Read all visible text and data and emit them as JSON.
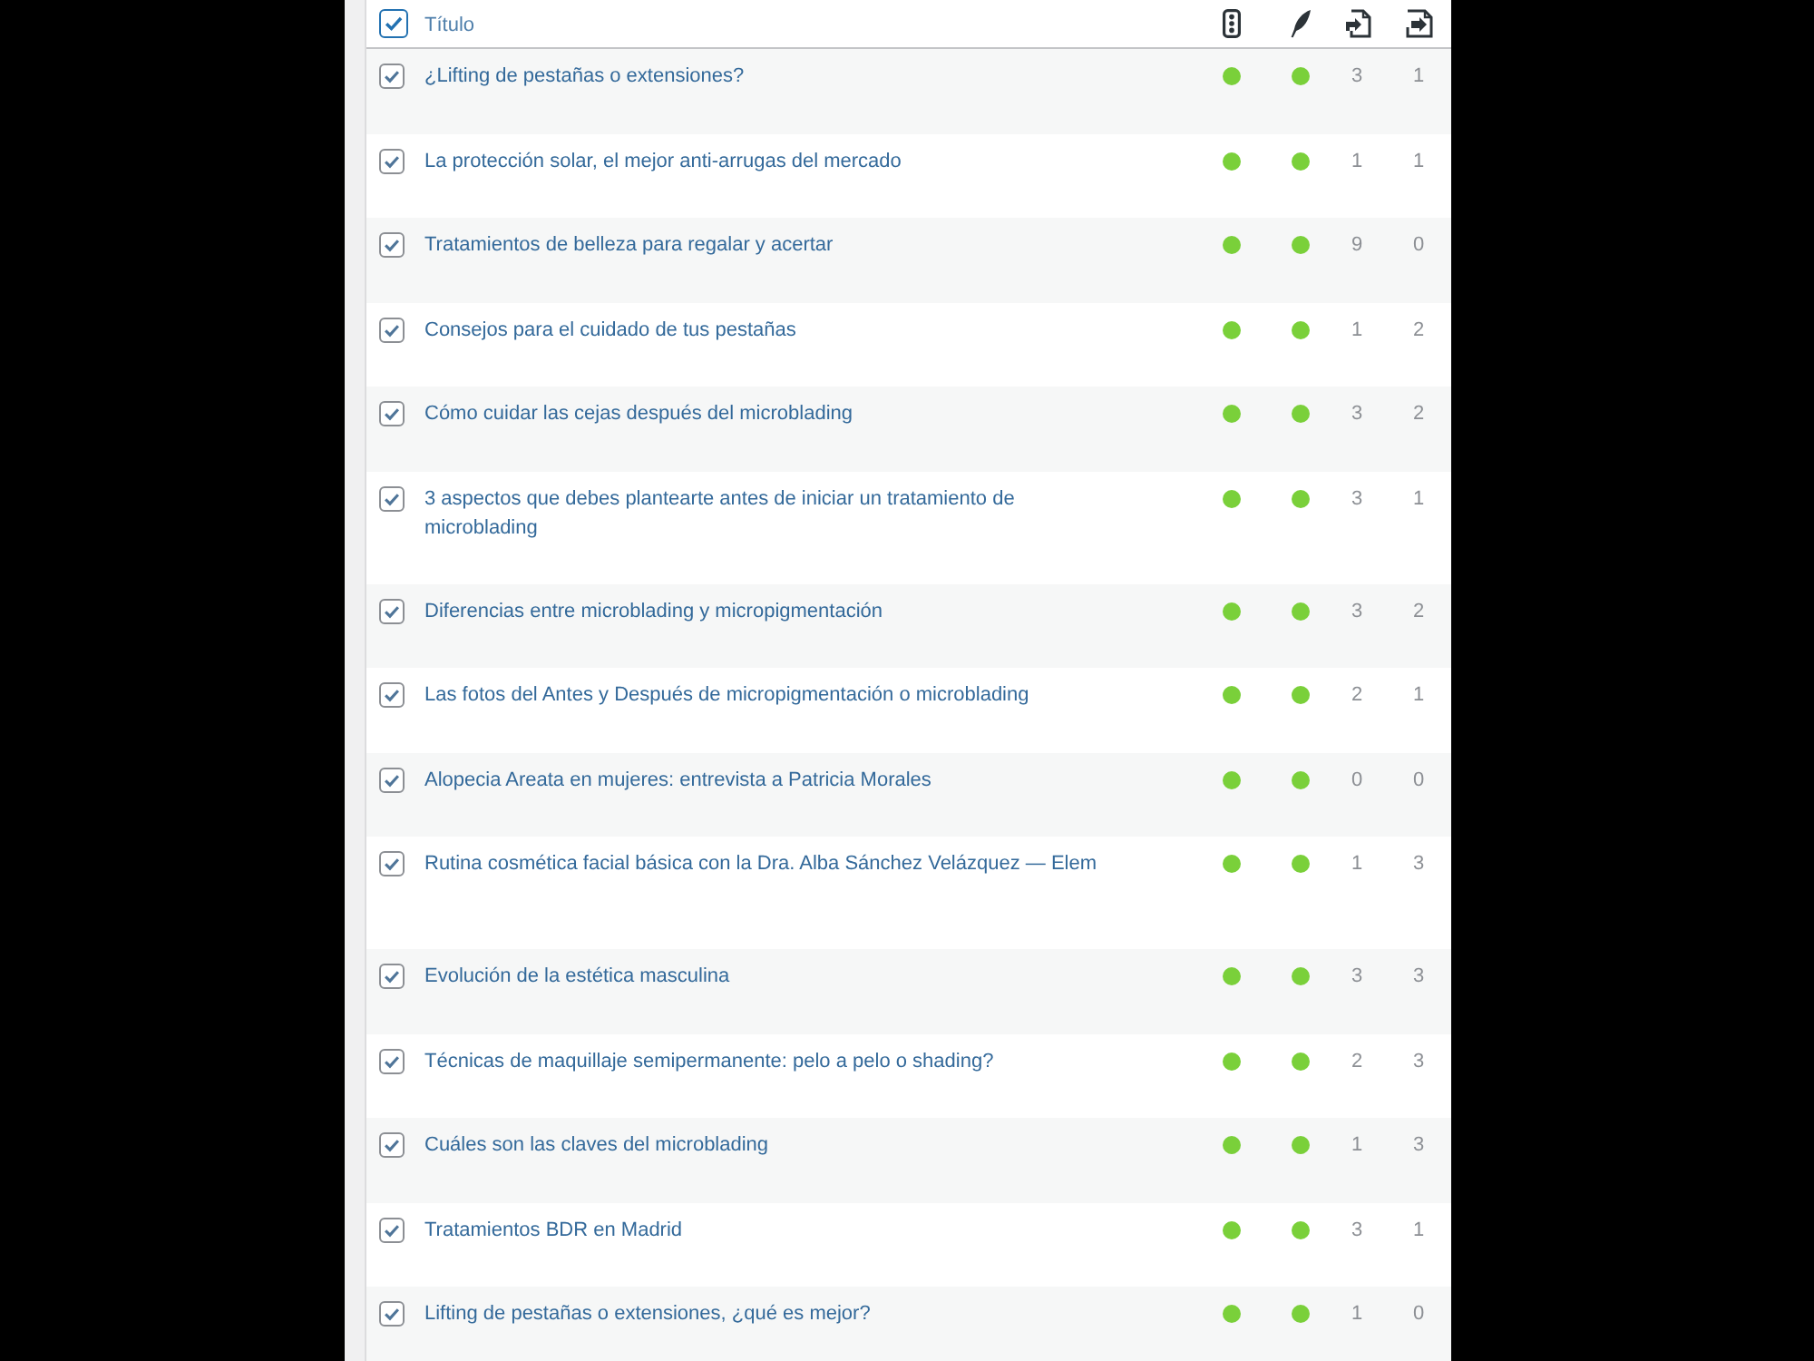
{
  "table": {
    "header": {
      "checked": true,
      "title": "Título"
    },
    "rows": [
      {
        "checked": true,
        "title": "¿Lifting de pestañas o extensiones?",
        "dots": [
          {
            "color": "#7ad03a"
          },
          {
            "color": "#7ad03a"
          }
        ],
        "counts": [
          "3",
          "1"
        ]
      },
      {
        "checked": true,
        "title": "La protección solar, el mejor anti-arrugas del mercado",
        "dots": [
          {
            "color": "#7ad03a"
          },
          {
            "color": "#7ad03a"
          }
        ],
        "counts": [
          "1",
          "1"
        ]
      },
      {
        "checked": true,
        "title": "Tratamientos de belleza para regalar y acertar",
        "dots": [
          {
            "color": "#7ad03a"
          },
          {
            "color": "#7ad03a"
          }
        ],
        "counts": [
          "9",
          "0"
        ]
      },
      {
        "checked": true,
        "title": "Consejos para el cuidado de tus pestañas",
        "dots": [
          {
            "color": "#7ad03a"
          },
          {
            "color": "#7ad03a"
          }
        ],
        "counts": [
          "1",
          "2"
        ]
      },
      {
        "checked": true,
        "title": "Cómo cuidar las cejas después del microblading",
        "dots": [
          {
            "color": "#7ad03a"
          },
          {
            "color": "#7ad03a"
          }
        ],
        "counts": [
          "3",
          "2"
        ]
      },
      {
        "checked": true,
        "title": "3 aspectos que debes plantearte antes de iniciar un tratamiento de microblading",
        "dots": [
          {
            "color": "#7ad03a"
          },
          {
            "color": "#7ad03a"
          }
        ],
        "counts": [
          "3",
          "1"
        ]
      },
      {
        "checked": true,
        "title": "Diferencias entre microblading y micropigmentación",
        "dots": [
          {
            "color": "#7ad03a"
          },
          {
            "color": "#7ad03a"
          }
        ],
        "counts": [
          "3",
          "2"
        ]
      },
      {
        "checked": true,
        "title": "Las fotos del Antes y Después de micropigmentación o microblading",
        "dots": [
          {
            "color": "#7ad03a"
          },
          {
            "color": "#7ad03a"
          }
        ],
        "counts": [
          "2",
          "1"
        ]
      },
      {
        "checked": true,
        "title": "Alopecia Areata en mujeres: entrevista a Patricia Morales",
        "dots": [
          {
            "color": "#7ad03a"
          },
          {
            "color": "#7ad03a"
          }
        ],
        "counts": [
          "0",
          "0"
        ]
      },
      {
        "checked": true,
        "title": "Rutina cosmética facial básica con la Dra. Alba Sánchez Velázquez — Elem",
        "dots": [
          {
            "color": "#7ad03a"
          },
          {
            "color": "#7ad03a"
          }
        ],
        "counts": [
          "1",
          "3"
        ]
      },
      {
        "checked": true,
        "title": "Evolución de la estética masculina",
        "dots": [
          {
            "color": "#7ad03a"
          },
          {
            "color": "#7ad03a"
          }
        ],
        "counts": [
          "3",
          "3"
        ]
      },
      {
        "checked": true,
        "title": "Técnicas de maquillaje semipermanente: pelo a pelo o shading?",
        "dots": [
          {
            "color": "#7ad03a"
          },
          {
            "color": "#7ad03a"
          }
        ],
        "counts": [
          "2",
          "3"
        ]
      },
      {
        "checked": true,
        "title": "Cuáles son las claves del microblading",
        "dots": [
          {
            "color": "#7ad03a"
          },
          {
            "color": "#7ad03a"
          }
        ],
        "counts": [
          "1",
          "3"
        ]
      },
      {
        "checked": true,
        "title": "Tratamientos BDR en Madrid",
        "dots": [
          {
            "color": "#7ad03a"
          },
          {
            "color": "#7ad03a"
          }
        ],
        "counts": [
          "3",
          "1"
        ]
      },
      {
        "checked": true,
        "title": "Lifting de pestañas o extensiones, ¿qué es mejor?",
        "dots": [
          {
            "color": "#7ad03a"
          },
          {
            "color": "#7ad03a"
          }
        ],
        "counts": [
          "1",
          "0"
        ]
      }
    ]
  }
}
